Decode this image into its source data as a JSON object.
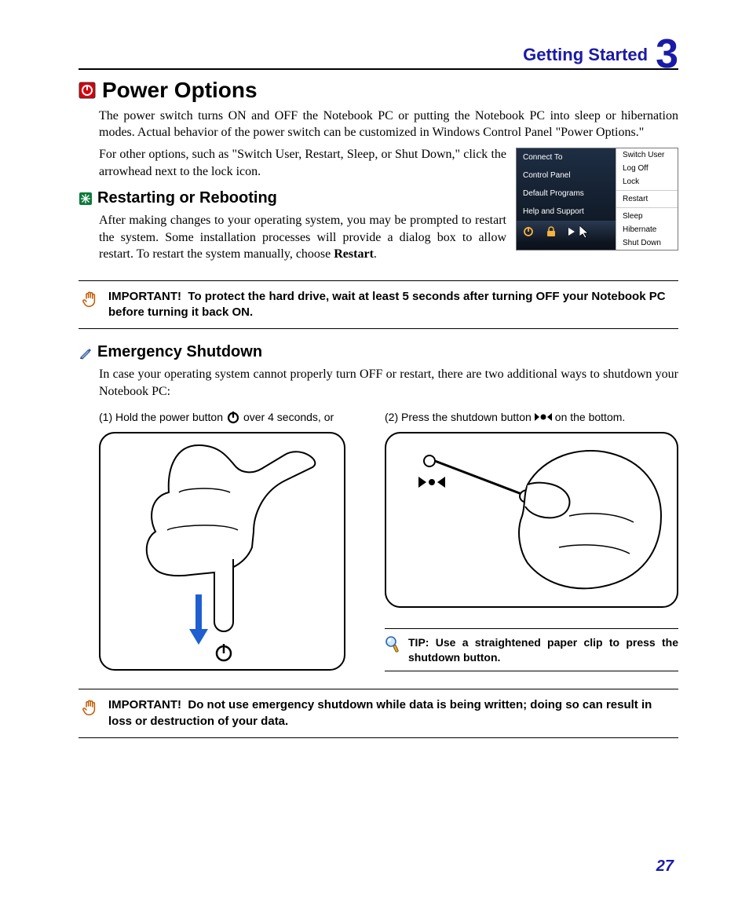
{
  "chapter": {
    "title": "Getting Started",
    "number": "3"
  },
  "power_options": {
    "heading": "Power Options",
    "p1": "The power switch turns ON and OFF the Notebook PC or putting the Notebook PC into sleep or hibernation modes. Actual behavior of the power switch can be customized in Windows Control Panel \"Power Options.\"",
    "p2": "For other options, such as \"Switch User, Restart, Sleep, or Shut Down,\" click the arrowhead next to the lock icon."
  },
  "menu": {
    "left": [
      "Connect To",
      "Control Panel",
      "Default Programs",
      "Help and Support"
    ],
    "right_group1": [
      "Switch User",
      "Log Off",
      "Lock"
    ],
    "right_group2": [
      "Restart"
    ],
    "right_group3": [
      "Sleep",
      "Hibernate",
      "Shut Down"
    ]
  },
  "restart": {
    "heading": "Restarting or Rebooting",
    "p_pre": "After making changes to your operating system, you may be prompted to restart the system. Some installation processes will provide a dialog box to allow restart. To restart the system manually, choose ",
    "p_strong": "Restart",
    "p_post": "."
  },
  "important1": {
    "label": "IMPORTANT!",
    "text": "To protect the hard drive, wait at least 5 seconds after turning OFF your Notebook PC before turning it back ON."
  },
  "emergency": {
    "heading": "Emergency Shutdown",
    "p": "In case your operating system cannot properly turn OFF or restart, there are two additional ways to shutdown your Notebook PC:"
  },
  "method1": {
    "pre": "(1) Hold the power button",
    "post": "over 4 seconds, or"
  },
  "method2": {
    "pre": "(2) Press the shutdown button",
    "post": "on the bottom."
  },
  "tip": {
    "label": "TIP:",
    "text": "Use a straightened paper clip to press the shutdown button."
  },
  "important2": {
    "label": "IMPORTANT!",
    "text": "Do not use emergency shutdown while data is being written; doing so can result in loss or destruction of your data."
  },
  "page_number": "27"
}
